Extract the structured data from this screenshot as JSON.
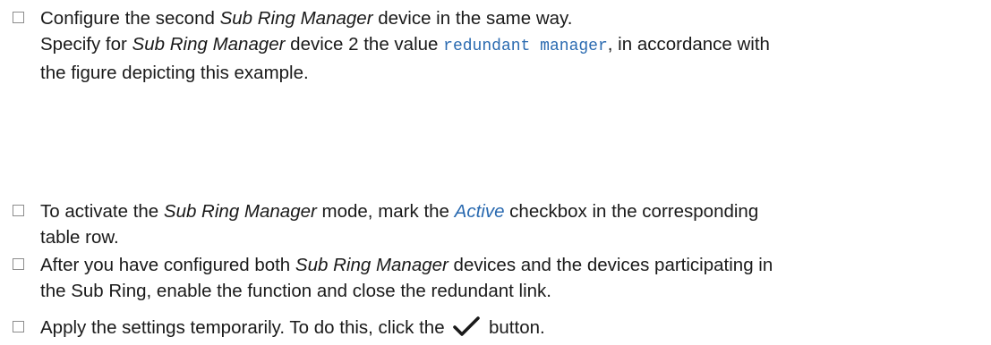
{
  "steps": [
    {
      "line1": {
        "pre": "Configure the second ",
        "em": "Sub Ring Manager",
        "post": " device in the same way."
      },
      "line2": {
        "pre": "Specify for ",
        "em": "Sub Ring Manager",
        "mid": " device 2 the value ",
        "code": "redundant manager",
        "post": ", in accordance with"
      },
      "line3": "the figure depicting this example."
    },
    {
      "line1": {
        "pre": "To activate the ",
        "em": "Sub Ring Manager",
        "mid": " mode, mark the ",
        "link": "Active",
        "post": " checkbox in the corresponding"
      },
      "line2": "table row."
    },
    {
      "line1": {
        "pre": "After you have configured both ",
        "em": "Sub Ring Manager",
        "post": " devices and the devices participating in"
      },
      "line2": "the Sub Ring, enable the function and close the redundant link."
    },
    {
      "pre": "Apply the settings temporarily. To do this, click the",
      "icon": "checkmark-icon",
      "post": "button."
    }
  ],
  "colors": {
    "text": "#1a1a1a",
    "accent": "#2a6ab0",
    "checkbox_border": "#8c8c8c"
  }
}
